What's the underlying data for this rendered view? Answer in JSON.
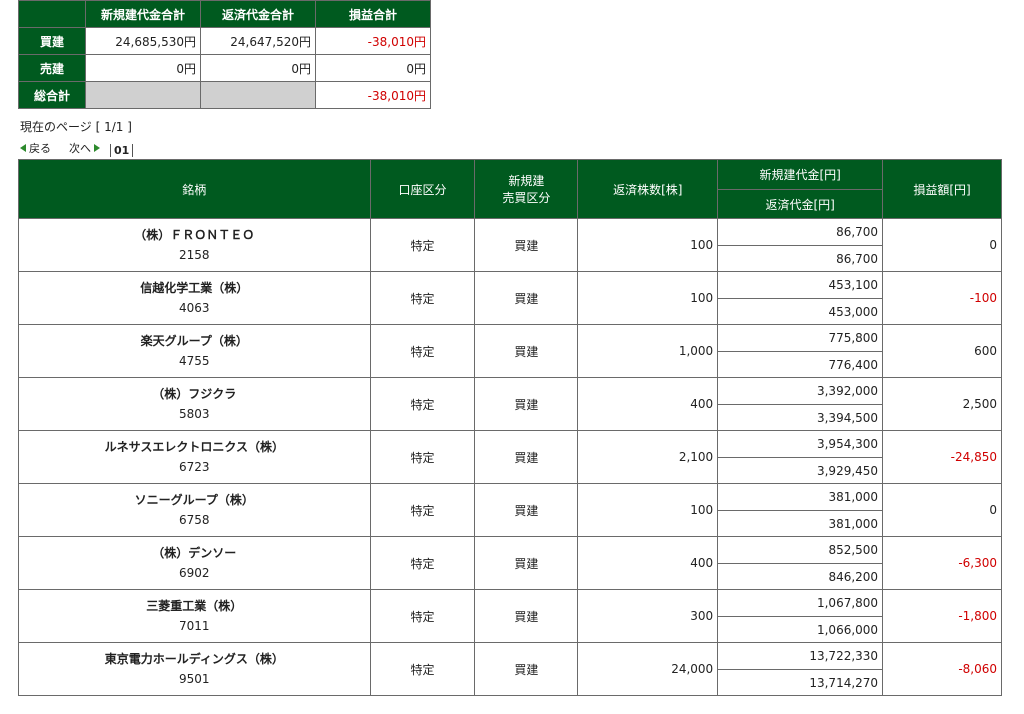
{
  "summary": {
    "headers": [
      "新規建代金合計",
      "返済代金合計",
      "損益合計"
    ],
    "rows": [
      {
        "label": "買建",
        "new_total": "24,685,530円",
        "repay_total": "24,647,520円",
        "pl": "-38,010円",
        "pl_negative": true
      },
      {
        "label": "売建",
        "new_total": "0円",
        "repay_total": "0円",
        "pl": "0円",
        "pl_negative": false
      },
      {
        "label": "総合計",
        "new_total": "",
        "repay_total": "",
        "pl": "-38,010円",
        "pl_negative": true
      }
    ]
  },
  "paging": {
    "current_page_text": "現在のページ [ 1/1 ]",
    "back_label": "戻る",
    "next_label": "次へ",
    "page_number": "01"
  },
  "table": {
    "headers": {
      "name": "銘柄",
      "account": "口座区分",
      "side_line1": "新規建",
      "side_line2": "売買区分",
      "qty": "返済株数[株]",
      "new_amount": "新規建代金[円]",
      "repay_amount": "返済代金[円]",
      "pl": "損益額[円]"
    },
    "rows": [
      {
        "name": "（株）ＦＲＯＮＴＥＯ",
        "code": "2158",
        "account": "特定",
        "side": "買建",
        "qty": "100",
        "new_amount": "86,700",
        "repay_amount": "86,700",
        "pl": "0",
        "pl_negative": false
      },
      {
        "name": "信越化学工業（株）",
        "code": "4063",
        "account": "特定",
        "side": "買建",
        "qty": "100",
        "new_amount": "453,100",
        "repay_amount": "453,000",
        "pl": "-100",
        "pl_negative": true
      },
      {
        "name": "楽天グループ（株）",
        "code": "4755",
        "account": "特定",
        "side": "買建",
        "qty": "1,000",
        "new_amount": "775,800",
        "repay_amount": "776,400",
        "pl": "600",
        "pl_negative": false
      },
      {
        "name": "（株）フジクラ",
        "code": "5803",
        "account": "特定",
        "side": "買建",
        "qty": "400",
        "new_amount": "3,392,000",
        "repay_amount": "3,394,500",
        "pl": "2,500",
        "pl_negative": false
      },
      {
        "name": "ルネサスエレクトロニクス（株）",
        "code": "6723",
        "account": "特定",
        "side": "買建",
        "qty": "2,100",
        "new_amount": "3,954,300",
        "repay_amount": "3,929,450",
        "pl": "-24,850",
        "pl_negative": true
      },
      {
        "name": "ソニーグループ（株）",
        "code": "6758",
        "account": "特定",
        "side": "買建",
        "qty": "100",
        "new_amount": "381,000",
        "repay_amount": "381,000",
        "pl": "0",
        "pl_negative": false
      },
      {
        "name": "（株）デンソー",
        "code": "6902",
        "account": "特定",
        "side": "買建",
        "qty": "400",
        "new_amount": "852,500",
        "repay_amount": "846,200",
        "pl": "-6,300",
        "pl_negative": true
      },
      {
        "name": "三菱重工業（株）",
        "code": "7011",
        "account": "特定",
        "side": "買建",
        "qty": "300",
        "new_amount": "1,067,800",
        "repay_amount": "1,066,000",
        "pl": "-1,800",
        "pl_negative": true
      },
      {
        "name": "東京電力ホールディングス（株）",
        "code": "9501",
        "account": "特定",
        "side": "買建",
        "qty": "24,000",
        "new_amount": "13,722,330",
        "repay_amount": "13,714,270",
        "pl": "-8,060",
        "pl_negative": true
      }
    ]
  },
  "colors": {
    "header_green": "#005a1f",
    "negative_red": "#d00000",
    "nav_arrow": "#2d8a2d",
    "gray_cell": "#d0d0d0"
  }
}
